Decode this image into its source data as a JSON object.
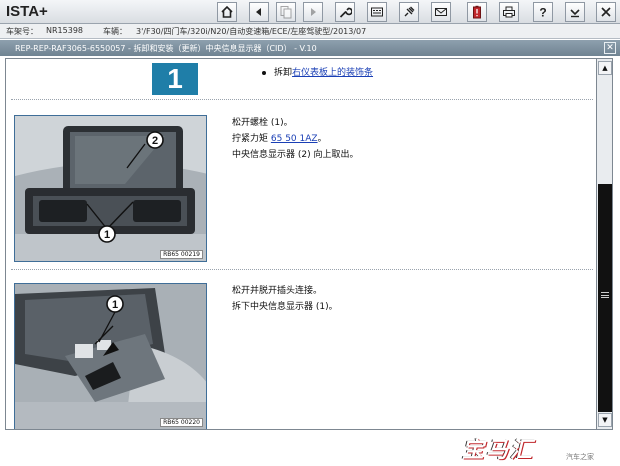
{
  "app": {
    "title": "ISTA+"
  },
  "toolbar": {
    "buttons": [
      {
        "icon": "home-icon",
        "label": "Home",
        "disabled": false
      },
      {
        "icon": "back-icon",
        "label": "Back",
        "disabled": false
      },
      {
        "icon": "document-copy-icon",
        "label": "Copy",
        "disabled": true
      },
      {
        "icon": "forward-icon",
        "label": "Forward",
        "disabled": true
      },
      {
        "icon": "wrench-icon",
        "label": "Service functions",
        "disabled": false
      },
      {
        "icon": "keyboard-icon",
        "label": "Measuring",
        "disabled": false
      },
      {
        "icon": "plug-icon",
        "label": "Connection",
        "disabled": false
      },
      {
        "icon": "mail-icon",
        "label": "Messages",
        "disabled": false
      },
      {
        "icon": "battery-warning-icon",
        "label": "Battery",
        "disabled": false
      },
      {
        "icon": "printer-icon",
        "label": "Print",
        "disabled": false
      },
      {
        "icon": "help-icon",
        "label": "Help",
        "disabled": false
      },
      {
        "icon": "minimize-icon",
        "label": "Minimize",
        "disabled": false
      },
      {
        "icon": "close-icon",
        "label": "Close",
        "disabled": false
      }
    ]
  },
  "vehicle": {
    "vin_label": "车架号：",
    "vin_value": "NR15398",
    "vehicle_label": "车辆：",
    "vehicle_value": "3'/F30/四门车/320i/N20/自动变速箱/ECE/左座驾驶型/2013/07"
  },
  "document": {
    "title": "REP-REP-RAF3065-6550057  -  拆卸和安装（更新）中央信息显示器（CID）  - V.10",
    "step_number": "1",
    "bullet": {
      "prefix": "拆卸",
      "link": "右仪表板上的装饰条"
    },
    "sections": [
      {
        "figure_code": "RB65 00219",
        "callouts": [
          "1",
          "2"
        ],
        "lines": [
          {
            "text": "松开螺栓 (1)。"
          },
          {
            "prefix": "拧紧力矩 ",
            "link": "65 50 1AZ",
            "suffix": "。"
          },
          {
            "text": "中央信息显示器 (2) 向上取出。"
          }
        ]
      },
      {
        "figure_code": "RB65 00220",
        "callouts": [
          "1"
        ],
        "lines": [
          {
            "text": "松开并脱开插头连接。"
          },
          {
            "text": "拆下中央信息显示器 (1)。"
          }
        ]
      }
    ]
  },
  "watermark": {
    "text": "宝马汇",
    "sub": "汽车之家"
  },
  "colors": {
    "accent": "#1f7ea8",
    "header": "#7b8e9c",
    "link": "#1a3fb5"
  }
}
